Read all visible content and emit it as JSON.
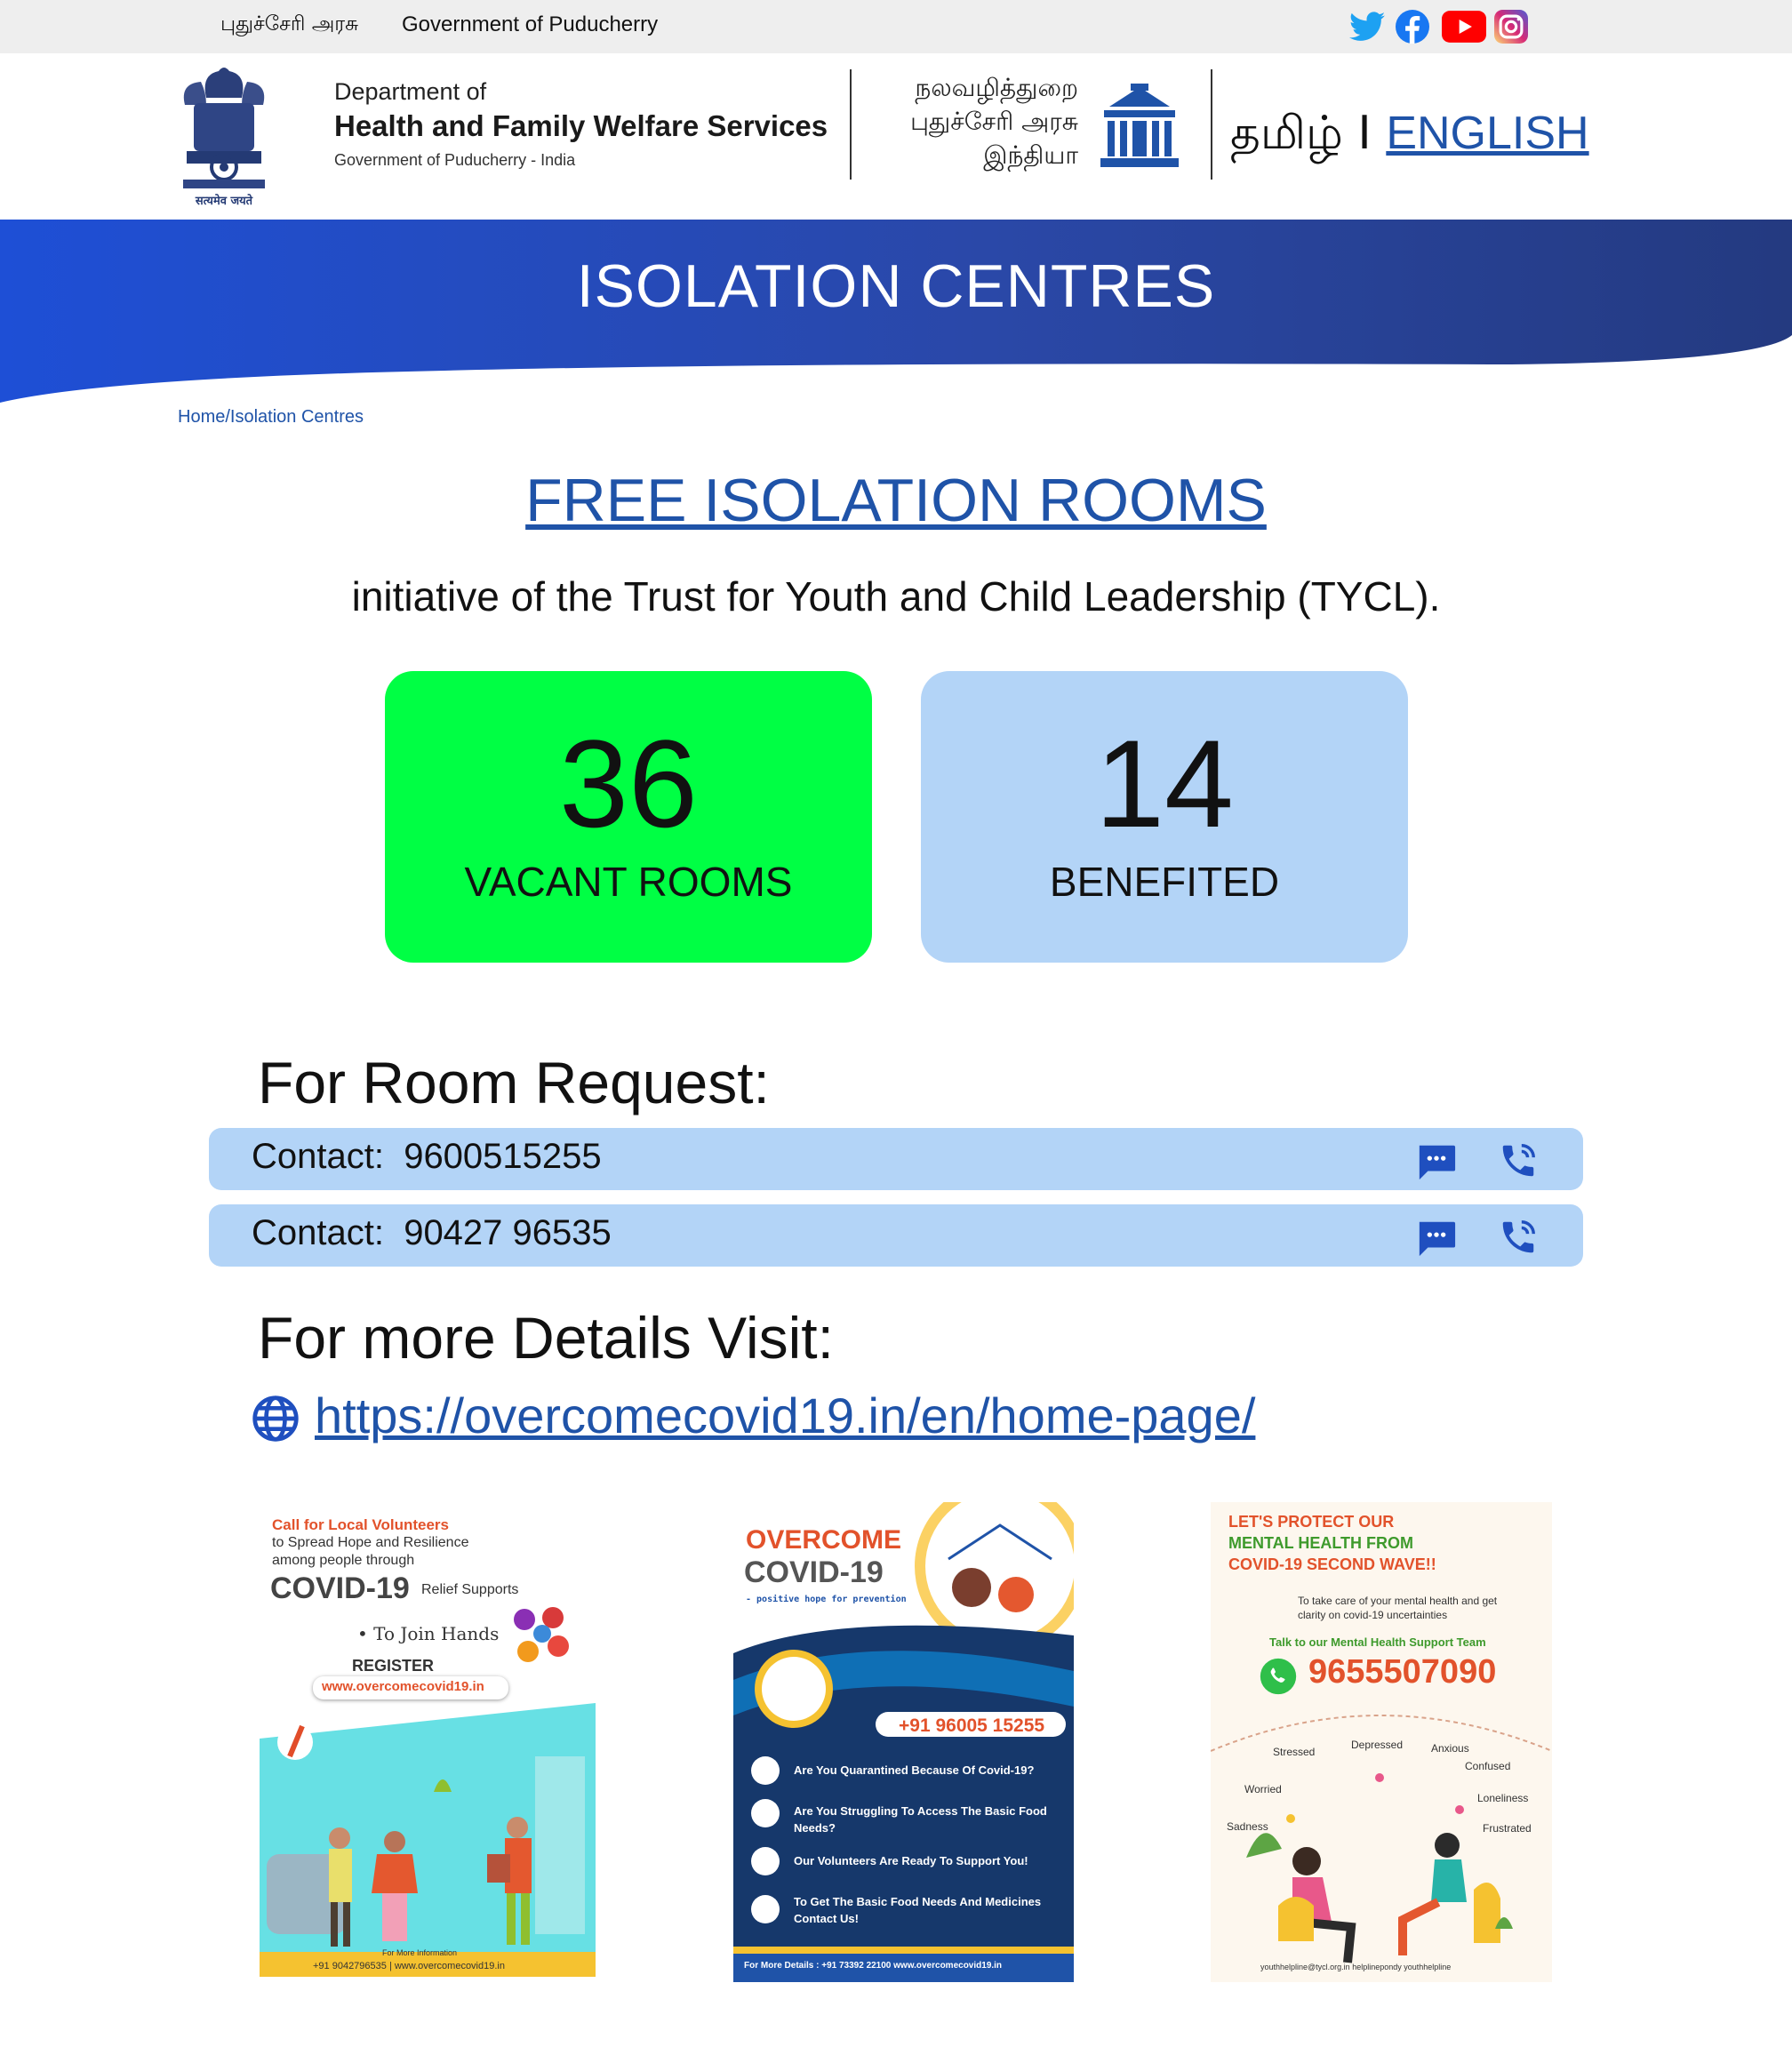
{
  "topbar": {
    "tamil_gov": "புதுச்சேரி அரசு",
    "gov": "Government of Puducherry",
    "social": [
      "twitter-icon",
      "facebook-icon",
      "youtube-icon",
      "instagram-icon"
    ]
  },
  "header": {
    "emblem_motto": "सत्यमेव जयते",
    "dept_small": "Department of",
    "dept_big": "Health and Family Welfare Services",
    "dept_sub": "Government of Puducherry - India",
    "tamil_lines": [
      "நலவழித்துறை",
      "புதுச்சேரி அரசு",
      "இந்தியா"
    ],
    "lang_tamil": "தமிழ்",
    "lang_sep": " I ",
    "lang_english": "ENGLISH"
  },
  "banner": {
    "title": "ISOLATION CENTRES",
    "gradient": [
      "#1e4fd6",
      "#243a80"
    ]
  },
  "breadcrumb": "Home/Isolation Centres",
  "main": {
    "title": "FREE ISOLATION ROOMS",
    "initiative": "initiative of the Trust for Youth and Child Leadership (TYCL).",
    "stats": [
      {
        "value": "36",
        "label": "VACANT ROOMS",
        "color": "#00ff44"
      },
      {
        "value": "14",
        "label": "BENEFITED",
        "color": "#b3d4f7"
      }
    ],
    "room_request_title": "For Room Request:",
    "contacts": [
      {
        "text": "Contact:  9600515255"
      },
      {
        "text": "Contact:  90427 96535"
      }
    ],
    "details_title": "For more Details Visit:",
    "link": "https://overcomecovid19.in/en/home-page/"
  },
  "posters": {
    "p1": {
      "l1": "Call for Local Volunteers",
      "l2": "to Spread Hope and Resilience",
      "l3": "among people through",
      "l4": "COVID-19",
      "l4b": "Relief Supports",
      "l5": "• To Join Hands",
      "l6": "REGISTER",
      "l7": "www.overcomecovid19.in",
      "foot1": "For More Information",
      "foot2": "+91 9042796535  |  www.overcomecovid19.in"
    },
    "p2": {
      "t1": "OVERCOME",
      "t2": "COVID-19",
      "t3": "- positive hope for prevention",
      "phone": "+91 96005 15255",
      "items": [
        "Are You Quarantined Because Of Covid-19?",
        "Are You Struggling To Access The Basic Food",
        "Needs?",
        "Our Volunteers Are Ready To Support You!",
        "To Get The Basic Food Needs And Medicines",
        "Contact Us!"
      ],
      "foot": "For More Details :  +91 73392 22100  www.overcomecovid19.in"
    },
    "p3": {
      "h1": "LET'S PROTECT OUR",
      "h2": "MENTAL HEALTH FROM",
      "h3": "COVID-19 SECOND WAVE!!",
      "b1": "To take care of your mental health and get",
      "b2": "clarity on covid-19 uncertainties",
      "b3": "Talk to our Mental Health Support Team",
      "phone": "9655507090",
      "words": [
        "Stressed",
        "Depressed",
        "Anxious",
        "Confused",
        "Worried",
        "Loneliness",
        "Sadness",
        "Frustrated"
      ],
      "foot": "youthhelpline@tycl.org.in   helplinepondy   youthhelpline"
    }
  }
}
